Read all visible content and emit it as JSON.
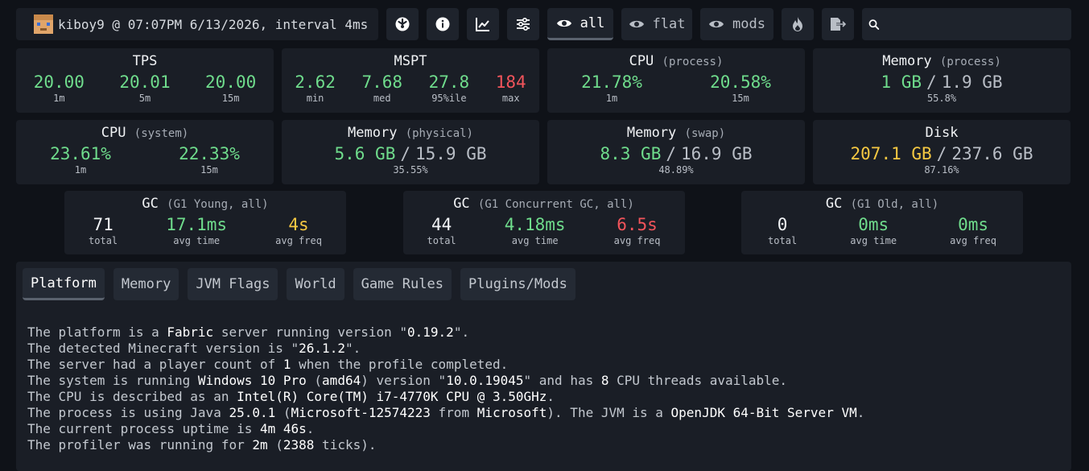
{
  "header": {
    "info": "kiboy9 @ 07:07PM 6/13/2026, interval 4ms",
    "buttons": {
      "all": "all",
      "flat": "flat",
      "mods": "mods"
    },
    "search_placeholder": ""
  },
  "cards": {
    "tps": {
      "title": "TPS",
      "v1": "20.00",
      "l1": "1m",
      "v2": "20.01",
      "l2": "5m",
      "v3": "20.00",
      "l3": "15m"
    },
    "mspt": {
      "title": "MSPT",
      "v1": "2.62",
      "l1": "min",
      "v2": "7.68",
      "l2": "med",
      "v3": "27.8",
      "l3": "95%ile",
      "v4": "184",
      "l4": "max"
    },
    "cpu_process": {
      "title": "CPU",
      "sub": "(process)",
      "v1": "21.78%",
      "l1": "1m",
      "v2": "20.58%",
      "l2": "15m"
    },
    "mem_process": {
      "title": "Memory",
      "sub": "(process)",
      "used": "1 GB",
      "sep": "/",
      "total": "1.9 GB",
      "pct": "55.8%"
    },
    "cpu_system": {
      "title": "CPU",
      "sub": "(system)",
      "v1": "23.61%",
      "l1": "1m",
      "v2": "22.33%",
      "l2": "15m"
    },
    "mem_physical": {
      "title": "Memory",
      "sub": "(physical)",
      "used": "5.6 GB",
      "sep": "/",
      "total": "15.9 GB",
      "pct": "35.55%"
    },
    "mem_swap": {
      "title": "Memory",
      "sub": "(swap)",
      "used": "8.3 GB",
      "sep": "/",
      "total": "16.9 GB",
      "pct": "48.89%"
    },
    "disk": {
      "title": "Disk",
      "used": "207.1 GB",
      "sep": "/",
      "total": "237.6 GB",
      "pct": "87.16%"
    }
  },
  "gc": [
    {
      "title": "GC",
      "sub": "(G1 Young, all)",
      "total": "71",
      "avg_time": "17.1ms",
      "avg_freq": "4s",
      "l_total": "total",
      "l_time": "avg time",
      "l_freq": "avg freq"
    },
    {
      "title": "GC",
      "sub": "(G1 Concurrent GC, all)",
      "total": "44",
      "avg_time": "4.18ms",
      "avg_freq": "6.5s",
      "l_total": "total",
      "l_time": "avg time",
      "l_freq": "avg freq"
    },
    {
      "title": "GC",
      "sub": "(G1 Old, all)",
      "total": "0",
      "avg_time": "0ms",
      "avg_freq": "0ms",
      "l_total": "total",
      "l_time": "avg time",
      "l_freq": "avg freq"
    }
  ],
  "tabs": [
    "Platform",
    "Memory",
    "JVM Flags",
    "World",
    "Game Rules",
    "Plugins/Mods"
  ],
  "platform_lines": [
    [
      [
        "The platform is a ",
        0
      ],
      [
        "Fabric",
        1
      ],
      [
        " server running version \"",
        0
      ],
      [
        "0.19.2",
        1
      ],
      [
        "\".",
        0
      ]
    ],
    [
      [
        "The detected Minecraft version is \"",
        0
      ],
      [
        "26.1.2",
        1
      ],
      [
        "\".",
        0
      ]
    ],
    [
      [
        "The server had a player count of ",
        0
      ],
      [
        "1",
        1
      ],
      [
        " when the profile completed.",
        0
      ]
    ],
    [
      [
        "The system is running ",
        0
      ],
      [
        "Windows 10 Pro",
        1
      ],
      [
        " (",
        0
      ],
      [
        "amd64",
        1
      ],
      [
        ") version \"",
        0
      ],
      [
        "10.0.19045",
        1
      ],
      [
        "\" and has ",
        0
      ],
      [
        "8",
        1
      ],
      [
        " CPU threads available.",
        0
      ]
    ],
    [
      [
        "The CPU is described as an ",
        0
      ],
      [
        "Intel(R) Core(TM) i7-4770K CPU @ 3.50GHz",
        1
      ],
      [
        ".",
        0
      ]
    ],
    [
      [
        "The process is using Java ",
        0
      ],
      [
        "25.0.1",
        1
      ],
      [
        " (",
        0
      ],
      [
        "Microsoft-12574223",
        1
      ],
      [
        " from ",
        0
      ],
      [
        "Microsoft",
        1
      ],
      [
        "). The JVM is a ",
        0
      ],
      [
        "OpenJDK 64-Bit Server VM",
        1
      ],
      [
        ".",
        0
      ]
    ],
    [
      [
        "The current process uptime is ",
        0
      ],
      [
        "4m 46s",
        1
      ],
      [
        ".",
        0
      ]
    ],
    [
      [
        "The profiler was running for ",
        0
      ],
      [
        "2m",
        1
      ],
      [
        " (",
        0
      ],
      [
        "2388",
        1
      ],
      [
        " ticks).",
        0
      ]
    ]
  ],
  "colors": {
    "good": "#6fdc8c",
    "bad": "#f2545b",
    "warn": "#f5c842",
    "bg": "#0f1218",
    "card": "#1a1e26"
  },
  "icons": [
    "dial-icon",
    "info-icon",
    "chart-icon",
    "sliders-icon",
    "eye-icon",
    "flame-icon",
    "export-icon",
    "search-icon"
  ]
}
